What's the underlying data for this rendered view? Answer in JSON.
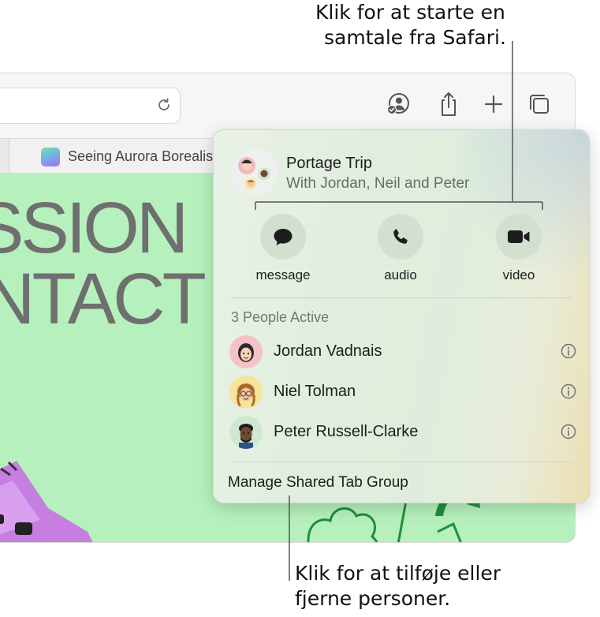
{
  "callouts": {
    "top_line1": "Klik for at starte en",
    "top_line2": "samtale fra Safari.",
    "bottom_line1": "Klik for at tilføje eller",
    "bottom_line2": "fjerne personer."
  },
  "browser": {
    "tab_title": "Seeing Aurora Borealis",
    "page_text_line1": "SSION",
    "page_text_line2": "NTACT",
    "toolbar_icons": [
      "reload-icon",
      "share-with-people-icon",
      "share-icon",
      "new-tab-plus-icon",
      "tab-overview-icon"
    ]
  },
  "popover": {
    "group_name": "Portage Trip",
    "group_members": "With Jordan, Neil and Peter",
    "actions": [
      {
        "label": "message",
        "icon": "message-bubble-icon"
      },
      {
        "label": "audio",
        "icon": "phone-icon"
      },
      {
        "label": "video",
        "icon": "video-camera-icon"
      }
    ],
    "people_header": "3 People Active",
    "people": [
      {
        "name": "Jordan Vadnais",
        "avatar_color": "#f5c2c7"
      },
      {
        "name": "Niel Tolman",
        "avatar_color": "#f7e39a"
      },
      {
        "name": "Peter Russell-Clarke",
        "avatar_color": "#cfe8cf"
      }
    ],
    "manage_label": "Manage Shared Tab Group"
  },
  "colors": {
    "page_green": "#b6f1bd",
    "callout_line": "#555555"
  }
}
